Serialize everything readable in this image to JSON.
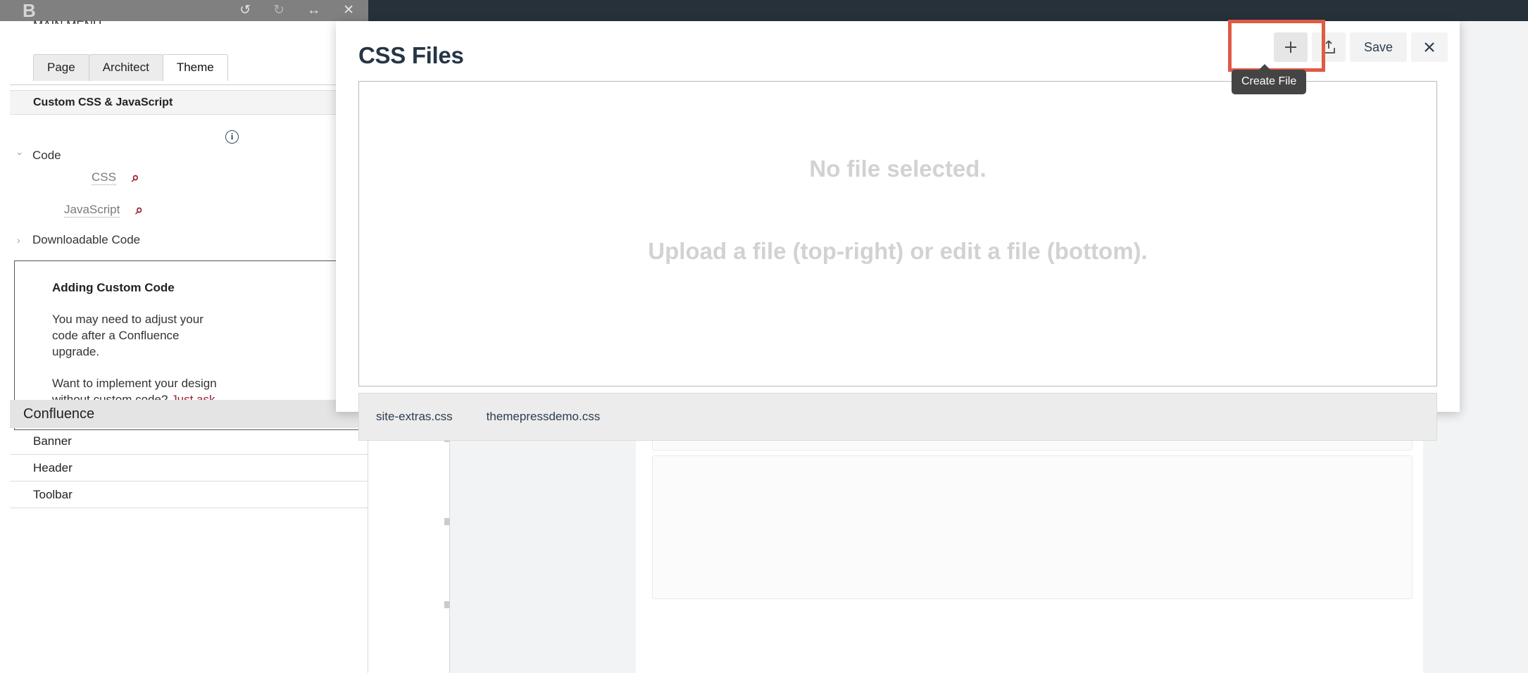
{
  "builder_toolbar": {
    "logo_text": "B",
    "icons": [
      {
        "name": "undo-icon",
        "glyph": "↺"
      },
      {
        "name": "redo-icon",
        "glyph": "↻"
      },
      {
        "name": "resize-icon",
        "glyph": "↔"
      },
      {
        "name": "close-icon",
        "glyph": "✕"
      }
    ]
  },
  "left_panel": {
    "clipped_title": "MAIN MENU",
    "tabs": [
      {
        "label": "Page",
        "active": false
      },
      {
        "label": "Architect",
        "active": false
      },
      {
        "label": "Theme",
        "active": true
      }
    ],
    "section_header": "Custom CSS & JavaScript",
    "info_icon_glyph": "i",
    "tree": {
      "code_label": "Code",
      "downloadable_label": "Downloadable Code",
      "leaves": [
        {
          "label": "CSS",
          "search_glyph": "⌕"
        },
        {
          "label": "JavaScript",
          "search_glyph": "⌕"
        }
      ]
    },
    "notice": {
      "title": "Adding Custom Code",
      "para1": "You may need to adjust your code after a Confluence upgrade.",
      "para2_prefix": "Want to implement your design without custom code? ",
      "para2_link": "Just ask",
      "para2_suffix": "."
    },
    "subheader": "Confluence",
    "nav_items": [
      "Banner",
      "Header",
      "Toolbar"
    ]
  },
  "modal": {
    "title": "CSS Files",
    "actions": {
      "create_glyph": "+",
      "create_name": "create-file-button",
      "upload_glyph": "⇧",
      "upload_name": "upload-file-button",
      "save_label": "Save",
      "close_glyph": "✕"
    },
    "tooltip": "Create File",
    "editor": {
      "line1": "No file selected.",
      "line2": "Upload a file (top-right) or edit a file (bottom)."
    },
    "files": [
      {
        "name": "site-extras.css"
      },
      {
        "name": "themepressdemo.css"
      }
    ]
  },
  "colors": {
    "highlight": "#e05a45",
    "tooltip_bg": "#444444",
    "accent_red": "#9c1b30",
    "dark_navy": "#263545",
    "topbar_dark": "#26313a",
    "builder_grey": "#808080"
  }
}
